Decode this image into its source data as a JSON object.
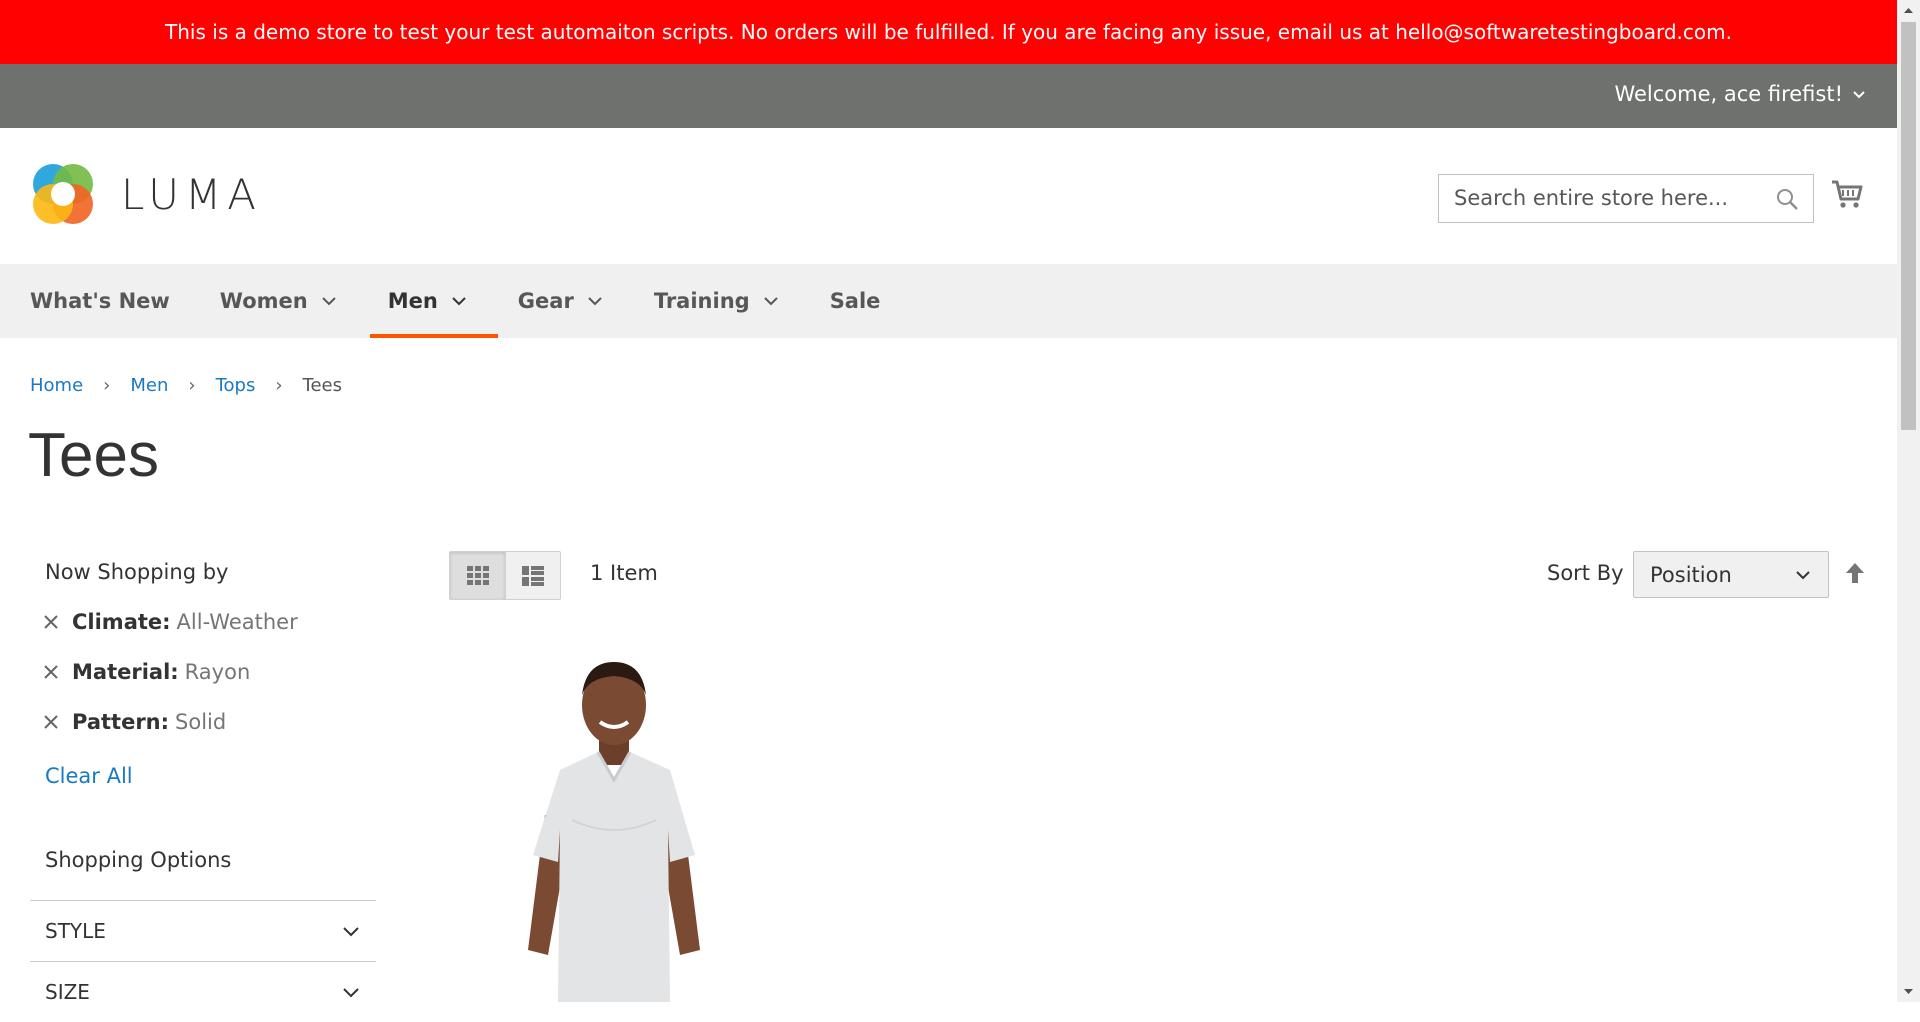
{
  "demo_notice": "This is a demo store to test your test automaiton scripts. No orders will be fulfilled. If you are facing any issue, email us at hello@softwaretestingboard.com.",
  "header": {
    "welcome": "Welcome, ace firefist!",
    "logo_text": "LUMA",
    "search_placeholder": "Search entire store here..."
  },
  "nav": {
    "items": [
      {
        "label": "What's New"
      },
      {
        "label": "Women"
      },
      {
        "label": "Men"
      },
      {
        "label": "Gear"
      },
      {
        "label": "Training"
      },
      {
        "label": "Sale"
      }
    ]
  },
  "breadcrumb": {
    "items": [
      "Home",
      "Men",
      "Tops"
    ],
    "current": "Tees"
  },
  "page_title": "Tees",
  "sidebar": {
    "now_shopping_title": "Now Shopping by",
    "filters": [
      {
        "label": "Climate:",
        "value": "All-Weather"
      },
      {
        "label": "Material:",
        "value": "Rayon"
      },
      {
        "label": "Pattern:",
        "value": "Solid"
      }
    ],
    "clear_all": "Clear All",
    "shopping_options_title": "Shopping Options",
    "options": [
      "STYLE",
      "SIZE"
    ]
  },
  "toolbar": {
    "amount": "1 Item",
    "sort_label": "Sort By",
    "sort_value": "Position"
  },
  "colors": {
    "demo_bar": "#ff0101",
    "panel_header": "#6e716e",
    "link": "#1979c3",
    "nav_active": "#ff5501"
  }
}
